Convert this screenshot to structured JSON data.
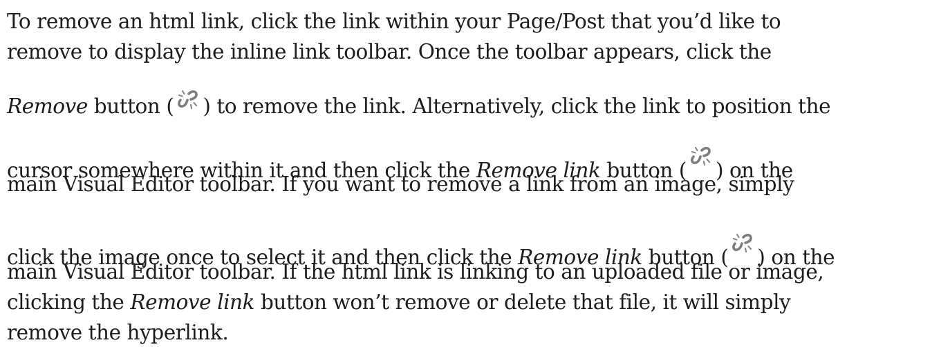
{
  "document": {
    "line1": "To remove an html link, click the link within your Page/Post that you’d like to",
    "line2": "remove to display the inline link toolbar. Once the toolbar appears, click the",
    "line3": {
      "em": "Remove",
      "a": " button (",
      "b": ") to remove the link. Alternatively, click the link to position the"
    },
    "line4": {
      "a": "cursor somewhere within it and then click the ",
      "em": "Remove link",
      "b": " button (",
      "c": ") on the"
    },
    "line5": "main Visual Editor toolbar. If you want to remove a link from an image, simply",
    "line6": {
      "a": "click the image once to select it and then click the ",
      "em": "Remove link",
      "b": " button (",
      "c": ") on the"
    },
    "line7": "main Visual Editor toolbar. If the html link is linking to an uploaded file or image,",
    "line8": {
      "a": "clicking the ",
      "em": "Remove link",
      "b": " button won’t remove or delete that file, it will simply"
    },
    "line9": "remove the hyperlink.",
    "icon_name": "unlink-icon"
  }
}
